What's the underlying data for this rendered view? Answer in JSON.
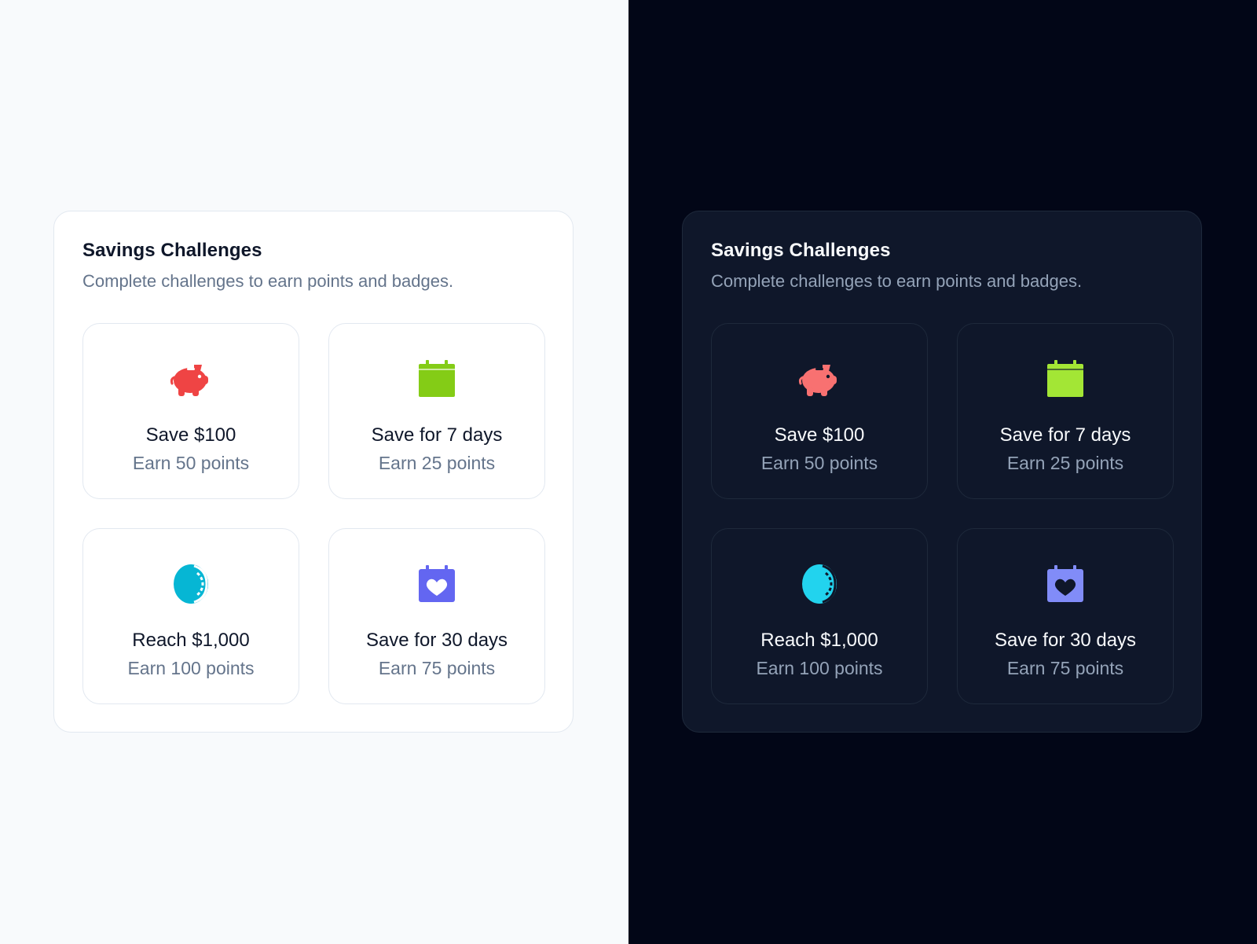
{
  "themes": [
    {
      "name": "light",
      "panel": {
        "title": "Savings Challenges",
        "subtitle": "Complete challenges to earn points and badges."
      },
      "challenges": [
        {
          "title": "Save $100",
          "points": "Earn 50 points",
          "icon": "piggy-bank-icon",
          "color": "#ef4444"
        },
        {
          "title": "Save for 7 days",
          "points": "Earn 25 points",
          "icon": "calendar-icon",
          "color": "#84cc16"
        },
        {
          "title": "Reach $1,000",
          "points": "Earn 100 points",
          "icon": "coin-icon",
          "color": "#06b6d4"
        },
        {
          "title": "Save for 30 days",
          "points": "Earn 75 points",
          "icon": "calendar-heart-icon",
          "color": "#6366f1"
        }
      ]
    },
    {
      "name": "dark",
      "panel": {
        "title": "Savings Challenges",
        "subtitle": "Complete challenges to earn points and badges."
      },
      "challenges": [
        {
          "title": "Save $100",
          "points": "Earn 50 points",
          "icon": "piggy-bank-icon",
          "color": "#f87171"
        },
        {
          "title": "Save for 7 days",
          "points": "Earn 25 points",
          "icon": "calendar-icon",
          "color": "#a3e635"
        },
        {
          "title": "Reach $1,000",
          "points": "Earn 100 points",
          "icon": "coin-icon",
          "color": "#22d3ee"
        },
        {
          "title": "Save for 30 days",
          "points": "Earn 75 points",
          "icon": "calendar-heart-icon",
          "color": "#818cf8"
        }
      ]
    }
  ]
}
